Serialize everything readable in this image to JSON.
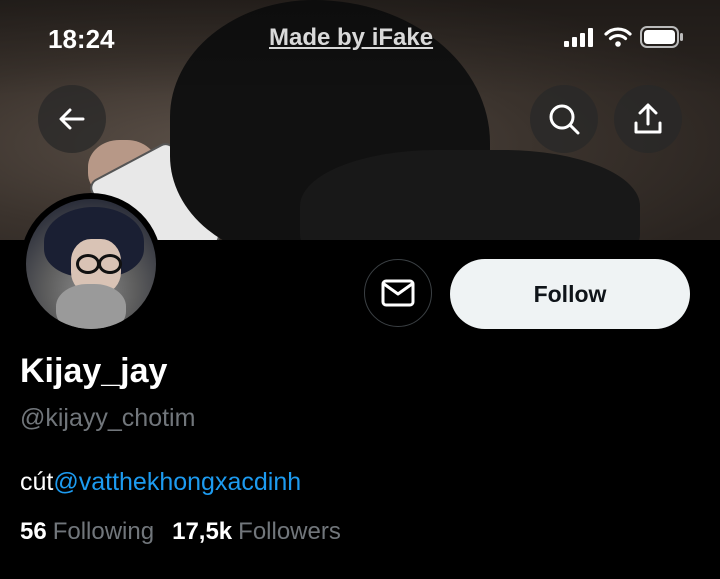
{
  "status_bar": {
    "time": "18:24",
    "watermark": "Made by iFake",
    "icons": [
      "signal-icon",
      "wifi-icon",
      "battery-icon"
    ]
  },
  "header": {
    "back_icon": "arrow-left-icon",
    "search_icon": "search-icon",
    "share_icon": "share-icon"
  },
  "profile": {
    "display_name": "Kijay_jay",
    "handle": "@kijayy_chotim",
    "bio_text": "cút",
    "bio_mention": "@vatthekhongxacdinh",
    "following_count": "56",
    "following_label": "Following",
    "followers_count": "17,5k",
    "followers_label": "Followers"
  },
  "actions": {
    "message_icon": "mail-icon",
    "follow_label": "Follow"
  },
  "colors": {
    "background": "#000000",
    "mention": "#1d9bf0",
    "secondary_text": "#71767b",
    "follow_button_bg": "#eff3f4"
  }
}
